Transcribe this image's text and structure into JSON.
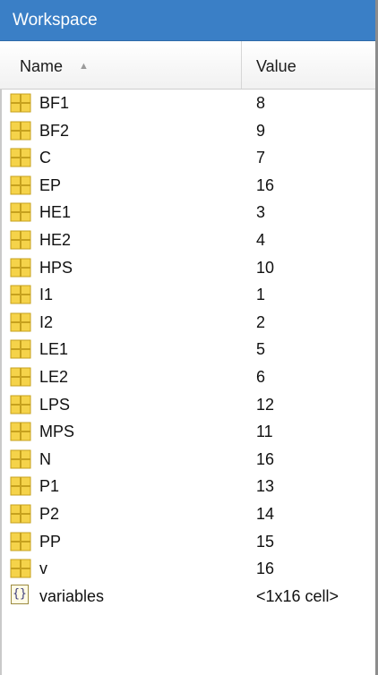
{
  "panel": {
    "title": "Workspace",
    "columns": {
      "name": "Name",
      "value": "Value"
    },
    "sort_indicator": "▲"
  },
  "variables": [
    {
      "name": "BF1",
      "value": "8",
      "icon": "matrix-icon"
    },
    {
      "name": "BF2",
      "value": "9",
      "icon": "matrix-icon"
    },
    {
      "name": "C",
      "value": "7",
      "icon": "matrix-icon"
    },
    {
      "name": "EP",
      "value": "16",
      "icon": "matrix-icon"
    },
    {
      "name": "HE1",
      "value": "3",
      "icon": "matrix-icon"
    },
    {
      "name": "HE2",
      "value": "4",
      "icon": "matrix-icon"
    },
    {
      "name": "HPS",
      "value": "10",
      "icon": "matrix-icon"
    },
    {
      "name": "I1",
      "value": "1",
      "icon": "matrix-icon"
    },
    {
      "name": "I2",
      "value": "2",
      "icon": "matrix-icon"
    },
    {
      "name": "LE1",
      "value": "5",
      "icon": "matrix-icon"
    },
    {
      "name": "LE2",
      "value": "6",
      "icon": "matrix-icon"
    },
    {
      "name": "LPS",
      "value": "12",
      "icon": "matrix-icon"
    },
    {
      "name": "MPS",
      "value": "11",
      "icon": "matrix-icon"
    },
    {
      "name": "N",
      "value": "16",
      "icon": "matrix-icon"
    },
    {
      "name": "P1",
      "value": "13",
      "icon": "matrix-icon"
    },
    {
      "name": "P2",
      "value": "14",
      "icon": "matrix-icon"
    },
    {
      "name": "PP",
      "value": "15",
      "icon": "matrix-icon"
    },
    {
      "name": "v",
      "value": "16",
      "icon": "matrix-icon"
    },
    {
      "name": "variables",
      "value": "<1x16 cell>",
      "icon": "cell-array-icon",
      "icon_glyph": "{}"
    }
  ],
  "colors": {
    "titlebar": "#3a7fc6",
    "matrix_fill": "#f5d34a",
    "matrix_stroke": "#c6a11e"
  }
}
